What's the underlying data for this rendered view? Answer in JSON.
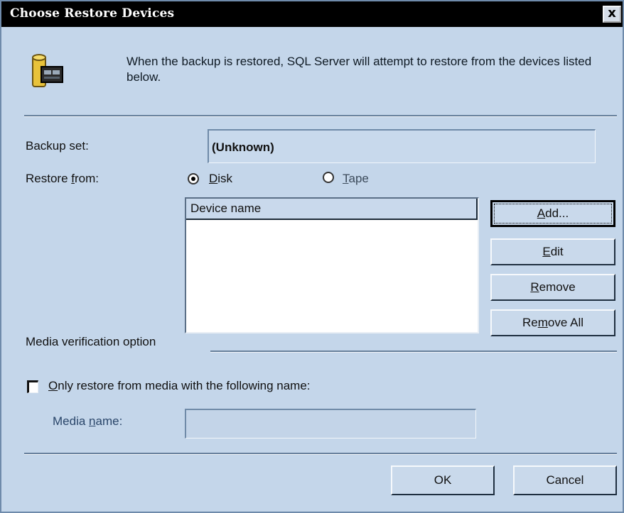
{
  "window": {
    "title": "Choose Restore Devices",
    "close_label": "x"
  },
  "intro": {
    "text": "When the backup is restored, SQL Server will attempt to restore from the devices listed below."
  },
  "backup_set": {
    "label": "Backup set:",
    "value": "(Unknown)"
  },
  "restore_from": {
    "label_prefix": "Restore ",
    "label_access": "f",
    "label_rest": "rom:",
    "disk": {
      "access": "D",
      "rest": "isk",
      "selected": true
    },
    "tape": {
      "access": "T",
      "rest": "ape",
      "selected": false
    }
  },
  "device_list": {
    "column": "Device name",
    "rows": []
  },
  "buttons": {
    "add": {
      "access": "A",
      "rest": "dd..."
    },
    "edit": {
      "access": "E",
      "rest": "dit"
    },
    "remove": {
      "access": "R",
      "rest": "emove"
    },
    "remove_all": {
      "prefix": "Re",
      "access": "m",
      "rest": "ove All"
    },
    "ok": "OK",
    "cancel": "Cancel"
  },
  "media_verification": {
    "label": "Media verification option"
  },
  "only_restore": {
    "access": "O",
    "rest": "nly restore from media with the following name:",
    "checked": false
  },
  "media_name": {
    "prefix": "Media ",
    "access": "n",
    "rest": "ame:",
    "value": ""
  },
  "colors": {
    "titlebar": "#000000",
    "dialog_bg": "#c4d6ea",
    "list_bg": "#ffffff"
  }
}
